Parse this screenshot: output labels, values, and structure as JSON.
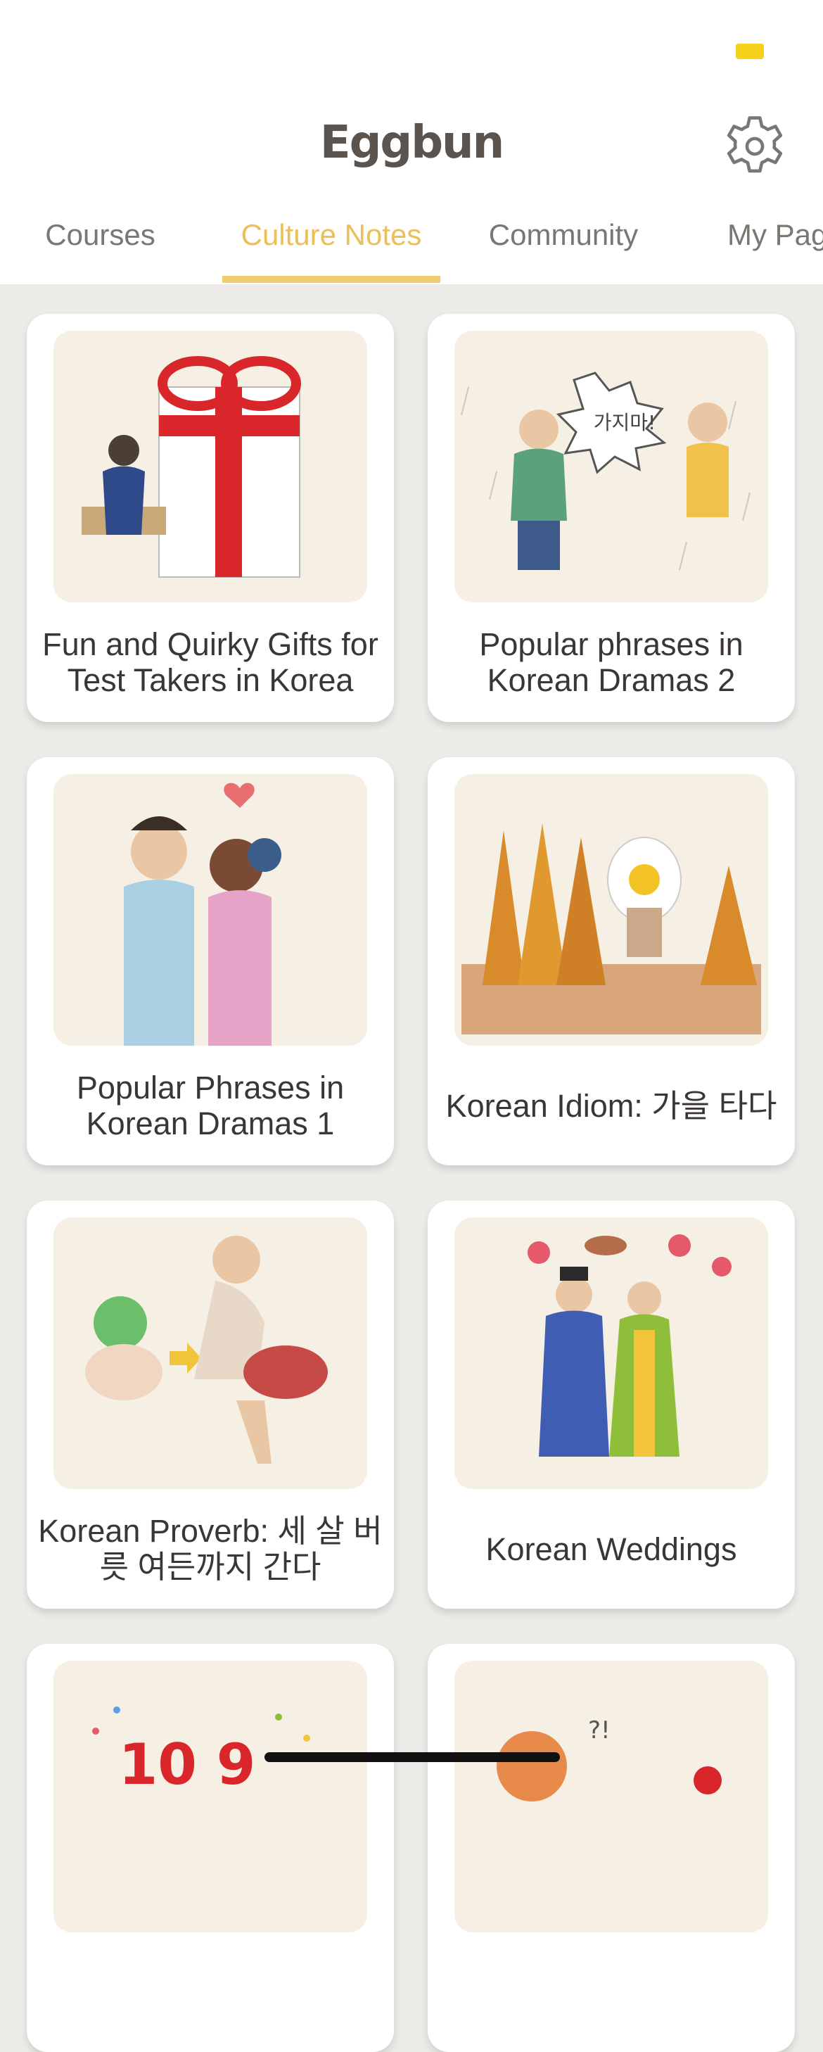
{
  "header": {
    "logo_text": "Eggbun",
    "settings_icon": "gear-icon"
  },
  "tabs": [
    {
      "label": "Courses",
      "active": false
    },
    {
      "label": "Culture Notes",
      "active": true
    },
    {
      "label": "Community",
      "active": false
    },
    {
      "label": "My Pag",
      "active": false
    }
  ],
  "colors": {
    "accent": "#ecbf58",
    "background": "#ecebe8",
    "card_image_bg": "#f6efe4"
  },
  "cards": [
    {
      "title": "Fun and Quirky Gifts for Test Takers in Korea",
      "image": "gift-box-illustration"
    },
    {
      "title": "Popular phrases in Korean Dramas 2",
      "image": "rain-scene-illustration",
      "image_text": "가지마!"
    },
    {
      "title": "Popular Phrases in Korean Dramas 1",
      "image": "couple-hug-illustration"
    },
    {
      "title": "Korean Idiom: 가을 타다",
      "image": "autumn-trees-illustration"
    },
    {
      "title": "Korean Proverb: 세 살 버릇 여든까지 간다",
      "image": "baby-and-old-man-illustration"
    },
    {
      "title": "Korean Weddings",
      "image": "traditional-wedding-illustration"
    },
    {
      "title": "",
      "image": "countdown-illustration",
      "image_text": "10 9"
    },
    {
      "title": "",
      "image": "surprised-woman-illustration",
      "image_text": "?!"
    }
  ]
}
